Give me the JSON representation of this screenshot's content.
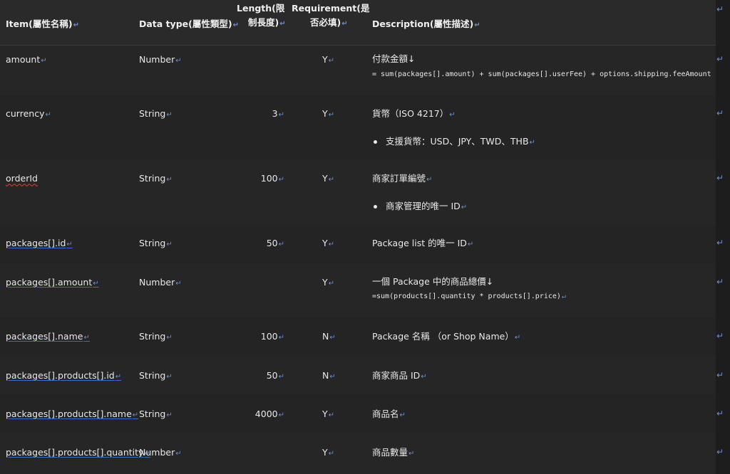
{
  "return_mark": "↵",
  "headers": {
    "item": "Item(屬性名稱)",
    "type": "Data type(屬性類型)",
    "length_l1": "Length(限",
    "length_l2": "制長度)",
    "req_l1": "Requirement(是",
    "req_l2": "否必填)",
    "desc": "Description(屬性描述)"
  },
  "rows": [
    {
      "item": "amount",
      "type": "Number",
      "length": "",
      "req": "Y",
      "desc": "付款金額↓",
      "extra": "= sum(packages[].amount) + sum(packages[].userFee) + options.shipping.feeAmount"
    },
    {
      "item": "currency",
      "type": "String",
      "length": "3",
      "req": "Y",
      "desc": "貨幣（ISO 4217）",
      "extra": "支援貨幣：USD、JPY、TWD、THB"
    },
    {
      "item": "orderId",
      "type": "String",
      "length": "100",
      "req": "Y",
      "desc": "商家訂單編號",
      "extra": "商家管理的唯一 ID"
    },
    {
      "item": "packages[].id",
      "type": "String",
      "length": "50",
      "req": "Y",
      "desc": "Package list 的唯一 ID",
      "extra": ""
    },
    {
      "item": "packages[].amount",
      "type": "Number",
      "length": "",
      "req": "Y",
      "desc": "一個 Package 中的商品總價↓",
      "extra": "=sum(products[].quantity * products[].price)"
    },
    {
      "item": "packages[].name",
      "type": "String",
      "length": "100",
      "req": "N",
      "desc": "Package 名稱 （or Shop Name）",
      "extra": ""
    },
    {
      "item": "packages[].products[].id",
      "type": "String",
      "length": "50",
      "req": "N",
      "desc": "商家商品 ID",
      "extra": ""
    },
    {
      "item": "packages[].products[].name",
      "type": "String",
      "length": "4000",
      "req": "Y",
      "desc": "商品名",
      "extra": ""
    },
    {
      "item": "packages[].products[].quantity",
      "type": "Number",
      "length": "",
      "req": "Y",
      "desc": "商品數量",
      "extra": ""
    }
  ]
}
